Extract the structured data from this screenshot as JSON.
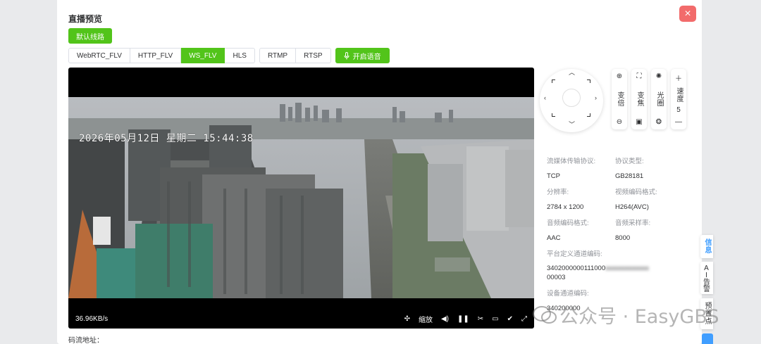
{
  "dialog": {
    "title": "直播预览",
    "close_icon": "×"
  },
  "route": {
    "label": "默认线路"
  },
  "protocol_tabs": {
    "group1": [
      "WebRTC_FLV",
      "HTTP_FLV",
      "WS_FLV",
      "HLS"
    ],
    "group2": [
      "RTMP",
      "RTSP"
    ],
    "active": "WS_FLV"
  },
  "voice": {
    "label": "开启语音",
    "icon": "microphone-icon"
  },
  "player": {
    "osd_text": "2026年05月12日  星期二  15:44:38",
    "bitrate": "36.96KB/s",
    "zoom_label": "缩放"
  },
  "ptz": {
    "zoom": "变倍",
    "focus": "变焦",
    "iris": "光圈",
    "speed_label": "速度",
    "speed_value": "5"
  },
  "stream_info": {
    "transport_label": "流媒体传输协议:",
    "transport_value": "TCP",
    "protocol_label": "协议类型:",
    "protocol_value": "GB28181",
    "resolution_label": "分辨率:",
    "resolution_value": "2784 x 1200",
    "video_codec_label": "视频编码格式:",
    "video_codec_value": "H264(AVC)",
    "audio_codec_label": "音频编码格式:",
    "audio_codec_value": "AAC",
    "sample_rate_label": "音频采样率:",
    "sample_rate_value": "8000",
    "platform_channel_label": "平台定义通道编码:",
    "platform_channel_value_a": "3402000000111000",
    "platform_channel_value_b": "00003",
    "device_channel_label": "设备通道编码:",
    "device_channel_value": "340200000"
  },
  "side_tabs": {
    "info": "信息",
    "ai_alarm": "AI告警",
    "preset": "预置点"
  },
  "stream_url_label": "码流地址：",
  "watermark": "公众号 · EasyGBS"
}
